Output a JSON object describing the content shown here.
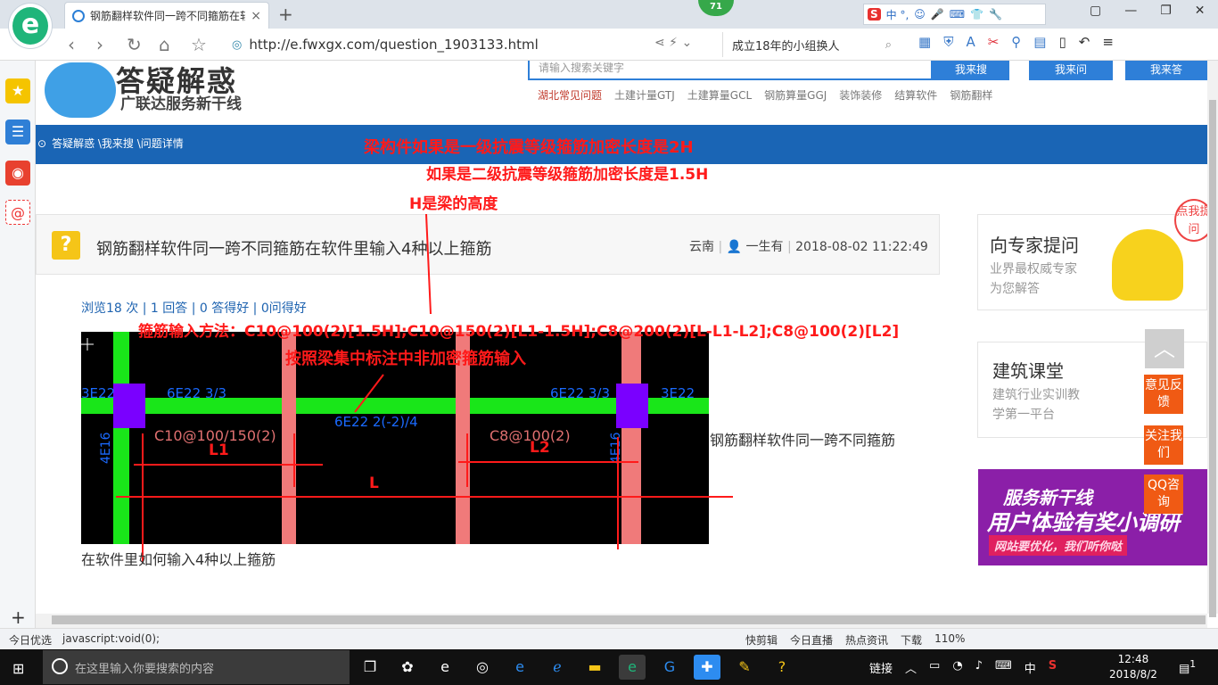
{
  "browser": {
    "logo": "e",
    "tab_title": "钢筋翻样软件同一跨不同箍筋在软",
    "tab_close": "×",
    "new_tab": "+",
    "badge": "71",
    "top_brand": "S",
    "top_brand_text": "中 °,",
    "url": "http://e.fwxgx.com/question_1903133.html",
    "search_suggest": "成立18年的小组换人",
    "window_buttons": [
      "▢",
      "—",
      "❐",
      "✕"
    ]
  },
  "sidebar": {
    "add": "+"
  },
  "site": {
    "title": "答疑解惑",
    "subtitle": "广联达服务新干线",
    "search_placeholder": "请输入搜索关键字",
    "search_buttons": [
      "我来搜",
      "我来问",
      "我来答"
    ],
    "categories": [
      "湖北常见问题",
      "土建计量GTJ",
      "土建算量GCL",
      "钢筋算量GGJ",
      "装饰装修",
      "结算软件",
      "钢筋翻样"
    ],
    "breadcrumb": "答疑解惑 \\我来搜 \\问题详情"
  },
  "question": {
    "icon": "?",
    "title": "钢筋翻样软件同一跨不同箍筋在软件里输入4种以上箍筋",
    "region": "云南",
    "user": "一生有",
    "datetime": "2018-08-02 11:22:49",
    "stats": "浏览18 次 | 1 回答 | 0 答得好 | 0问得好",
    "body_part1": "钢筋翻样软件同一跨不同箍筋",
    "body_part2": "在软件里如何输入4种以上箍筋"
  },
  "drawing": {
    "labels": [
      "3E22",
      "6E22 3/3",
      "6E22 3/3",
      "3E22",
      "6E22 2(-2)/4",
      "4E16",
      "C10@100/150(2)",
      "C8@100(2)",
      "4E16"
    ],
    "dims": [
      "L1",
      "L2",
      "L"
    ]
  },
  "annotations": {
    "line1": "梁构件如果是一级抗震等级箍筋加密长度是2H",
    "line2": "如果是二级抗震等级箍筋加密长度是1.5H",
    "line3": "H是梁的高度",
    "method": "箍筋输入方法：C10@100(2)[1.5H];C10@150(2)[L1-1.5H];C8@200(2)[L-L1-L2];C8@100(2)[L2]",
    "note": "按照梁集中标注中非加密箍筋输入"
  },
  "right": {
    "card1_title": "向专家提问",
    "card1_sub1": "业界最权威专家",
    "card1_sub2": "为您解答",
    "card1_bubble": "点我提问",
    "card2_title": "建筑课堂",
    "card2_sub1": "建筑行业实训教",
    "card2_sub2": "学第一平台",
    "banner_t1": "服务新干线",
    "banner_t2": "用户体验有奖小调研",
    "banner_t3": "网站要优化，我们听你哒",
    "float_top": "︿",
    "float1": "意见反馈",
    "float2": "关注我们",
    "float3": "QQ咨询"
  },
  "statusbar": {
    "left": [
      "今日优选",
      "javascript:void(0);"
    ],
    "right": [
      "快剪辑",
      "今日直播",
      "热点资讯",
      "下载",
      "110%"
    ]
  },
  "taskbar": {
    "search_placeholder": "在这里输入你要搜索的内容",
    "tray_text": "链接",
    "ime": "中",
    "time": "12:48",
    "date": "2018/8/2",
    "notification_count": "1"
  }
}
